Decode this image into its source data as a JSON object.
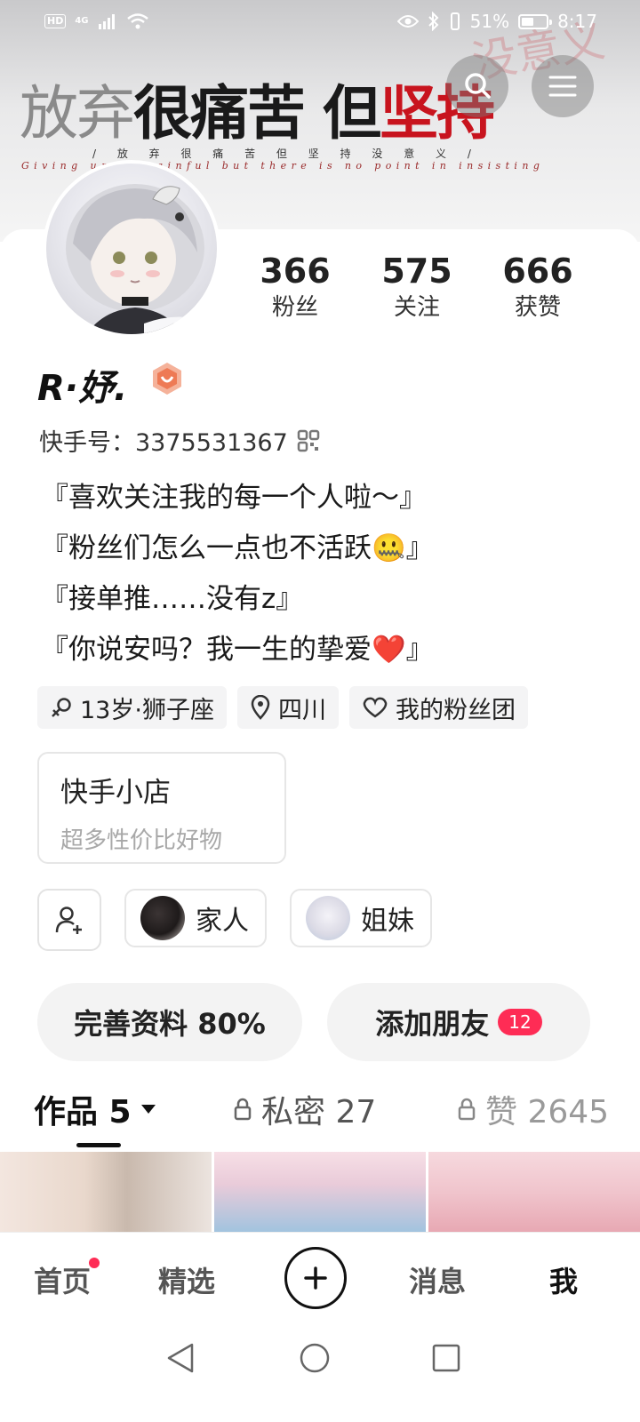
{
  "status_bar": {
    "hd": "HD",
    "network": "4G",
    "battery": "51%",
    "battery_level": 0.51,
    "time": "8:17"
  },
  "banner": {
    "title_part1": "放弃",
    "title_part2": "很痛苦 但",
    "title_part3": "坚持",
    "faint_text": "没意义",
    "subtitle": "/ 放 弃 很 痛 苦 但 坚 持 没 意 义 /",
    "english": "Giving up is painful but there is no point in insisting"
  },
  "top_buttons": {
    "search_icon": "search-icon",
    "menu_icon": "menu-icon"
  },
  "stats": [
    {
      "value": "366",
      "label": "粉丝"
    },
    {
      "value": "575",
      "label": "关注"
    },
    {
      "value": "666",
      "label": "获赞"
    }
  ],
  "profile": {
    "name": "R·妤.",
    "kuaishou_id": "快手号：3375531367",
    "bio": [
      "『喜欢关注我的每一个人啦～』",
      "『粉丝们怎么一点也不活跃🤐』",
      "『接单推……没有z』",
      "『你说安吗？我一生的挚爱❤️』"
    ]
  },
  "tags": [
    {
      "icon": "female-icon",
      "label": "13岁·狮子座"
    },
    {
      "icon": "location-icon",
      "label": "四川"
    },
    {
      "icon": "heart-icon",
      "label": "我的粉丝团"
    }
  ],
  "shop": {
    "title": "快手小店",
    "subtitle": "超多性价比好物"
  },
  "groups": [
    {
      "label": "家人"
    },
    {
      "label": "姐妹"
    }
  ],
  "actions": {
    "complete_profile": "完善资料 80%",
    "add_friends": "添加朋友",
    "add_friends_count": "12"
  },
  "tabs": [
    {
      "label": "作品 5"
    },
    {
      "label": "私密 27"
    },
    {
      "label": "赞 2645"
    }
  ],
  "bottom_nav": {
    "home": "首页",
    "featured": "精选",
    "messages": "消息",
    "me": "我"
  },
  "colors": {
    "accent": "#fe2c55",
    "banner_red": "#c8141e",
    "text": "#222222"
  }
}
